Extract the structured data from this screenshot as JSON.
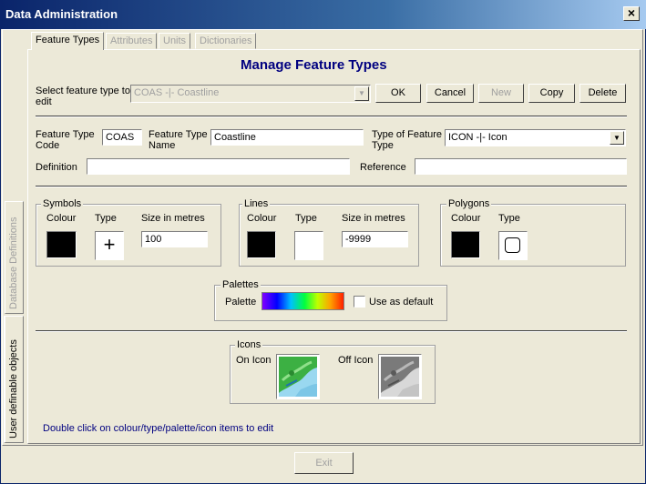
{
  "window": {
    "title": "Data Administration",
    "close_glyph": "×"
  },
  "side_tabs": [
    {
      "label": "Database Definitions"
    },
    {
      "label": "User definable objects"
    }
  ],
  "tabs": [
    {
      "label": "Feature Types"
    },
    {
      "label": "Attributes"
    },
    {
      "label": "Units"
    },
    {
      "label": "Dictionaries"
    }
  ],
  "page": {
    "heading": "Manage Feature Types",
    "select_label": "Select feature type to edit",
    "select_value": "COAS -|- Coastline",
    "buttons": {
      "ok": "OK",
      "cancel": "Cancel",
      "new": "New",
      "copy": "Copy",
      "delete": "Delete"
    },
    "code_label": "Feature Type Code",
    "code_value": "COAS",
    "name_label": "Feature Type Name",
    "name_value": "Coastline",
    "type_label": "Type of Feature Type",
    "type_value": "ICON -|- Icon",
    "definition_label": "Definition",
    "definition_value": "",
    "reference_label": "Reference",
    "reference_value": ""
  },
  "symbols": {
    "title": "Symbols",
    "colour_label": "Colour",
    "type_label": "Type",
    "size_label": "Size in metres",
    "size_value": "100",
    "type_glyph": "+",
    "colour": "#000000"
  },
  "lines": {
    "title": "Lines",
    "colour_label": "Colour",
    "type_label": "Type",
    "size_label": "Size in metres",
    "size_value": "-9999",
    "colour": "#000000"
  },
  "polygons": {
    "title": "Polygons",
    "colour_label": "Colour",
    "type_label": "Type",
    "colour": "#000000"
  },
  "palettes": {
    "title": "Palettes",
    "palette_label": "Palette",
    "default_label": "Use as default",
    "use_as_default": false
  },
  "icons": {
    "title": "Icons",
    "on_label": "On Icon",
    "off_label": "Off Icon"
  },
  "hint": "Double click on colour/type/palette/icon items to edit",
  "exit_label": "Exit",
  "colors": {
    "title_bar": "#0a246a",
    "heading": "#000080",
    "hint": "#000080",
    "disabled": "#a0a0a0"
  }
}
